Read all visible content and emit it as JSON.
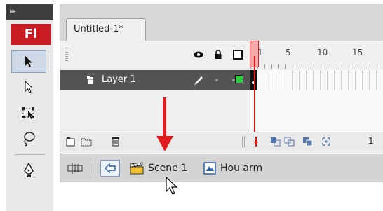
{
  "tools_panel": {
    "logo_text": "Fl",
    "tools": [
      {
        "name": "selection-tool",
        "icon": "arrow-black-icon",
        "active": true
      },
      {
        "name": "subselection-tool",
        "icon": "arrow-white-icon",
        "active": false
      },
      {
        "name": "free-transform-tool",
        "icon": "free-transform-icon",
        "active": false
      },
      {
        "name": "lasso-tool",
        "icon": "lasso-icon",
        "active": false
      },
      {
        "name": "pen-tool",
        "icon": "pen-icon",
        "active": false
      }
    ]
  },
  "document_tab": {
    "title": "Untitled-1*"
  },
  "timeline": {
    "header_icons": [
      "eye-icon",
      "lock-icon",
      "outline-icon"
    ],
    "ruler_numbers": [
      "1",
      "5",
      "10",
      "15"
    ],
    "layer": {
      "name": "Layer 1",
      "color": "#2ecc40"
    },
    "frame_count": "1",
    "playhead_color": "#e01b1b"
  },
  "edit_bar": {
    "scene_label": "Scene 1",
    "symbol_label": "Hou arm"
  },
  "colors": {
    "accent_red": "#e01b1b",
    "fl_brand": "#c81b22",
    "layer_row_bg": "#545454"
  }
}
